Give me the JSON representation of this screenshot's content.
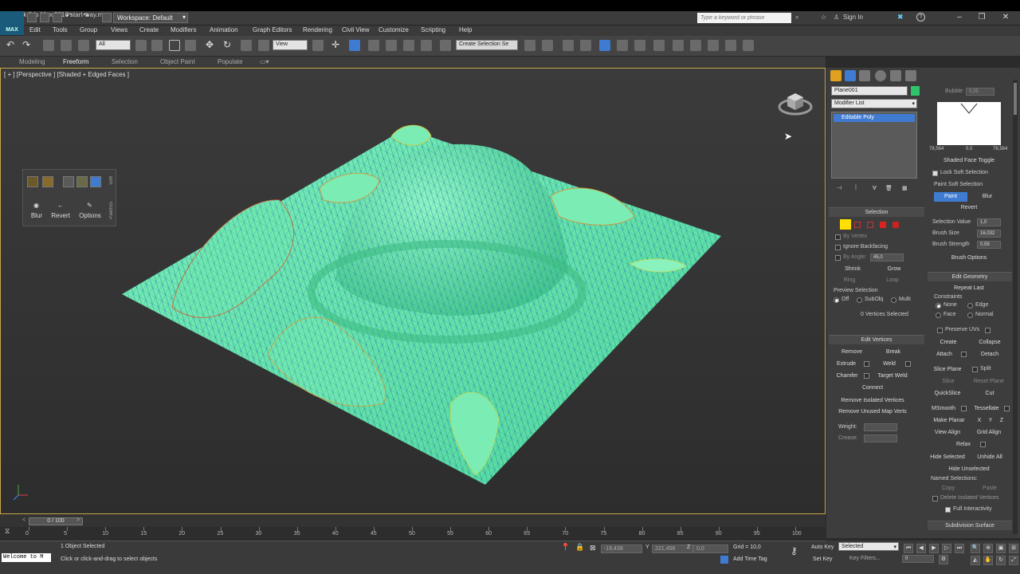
{
  "title_bar": {
    "workspace": "Workspace: Default",
    "app_title": "Autodesk 3ds Max 2016    start vray.max",
    "search_placeholder": "Type a keyword or phrase",
    "sign_in": "Sign In"
  },
  "logo": "MAX",
  "menu": [
    "Edit",
    "Tools",
    "Group",
    "Views",
    "Create",
    "Modifiers",
    "Animation",
    "Graph Editors",
    "Rendering",
    "Civil View",
    "Customize",
    "Scripting",
    "Help"
  ],
  "toolbar": {
    "filter_value": "All",
    "ref_coord_value": "View",
    "selection_set_value": "Create Selection Se"
  },
  "ribbon_tabs": [
    "Modeling",
    "Freeform",
    "Selection",
    "Object Paint",
    "Populate"
  ],
  "viewport": {
    "label": "[ + ] [Perspective ] [Shaded + Edged Faces ]"
  },
  "float_panel": {
    "blur": "Blur",
    "revert": "Revert",
    "options": "Options",
    "side_label_1": "Soft",
    "side_label_2": "PaintSS"
  },
  "command_panel": {
    "object_name": "Plane001",
    "modifier_list": "Modifier List",
    "stack_item": "Editable Poly",
    "selection_header": "Selection",
    "by_vertex": "By Vertex",
    "ignore_backfacing": "Ignore Backfacing",
    "by_angle": "By Angle:",
    "by_angle_value": "45,0",
    "shrink": "Shrink",
    "grow": "Grow",
    "ring": "Ring",
    "loop": "Loop",
    "preview_selection": "Preview Selection",
    "preview_off": "Off",
    "preview_subobj": "SubObj",
    "preview_multi": "Multi",
    "vertices_selected": "0 Vertices Selected",
    "edit_vertices_header": "Edit Vertices",
    "remove": "Remove",
    "break": "Break",
    "extrude": "Extrude",
    "weld": "Weld",
    "chamfer": "Chamfer",
    "target_weld": "Target Weld",
    "connect": "Connect",
    "remove_isolated": "Remove Isolated Vertices",
    "remove_unused": "Remove Unused Map Verts",
    "weight": "Weight:",
    "crease": "Crease:"
  },
  "soft_panel": {
    "bubble": "Bubble:",
    "bubble_value": "0,25",
    "curve_left": "78,564",
    "curve_mid": "0,0",
    "curve_right": "78,564",
    "shaded_face_toggle": "Shaded Face Toggle",
    "lock_soft_selection": "Lock Soft Selection",
    "paint_soft_selection": "Paint Soft Selection",
    "paint": "Paint",
    "blur": "Blur",
    "revert": "Revert",
    "selection_value_label": "Selection Value",
    "selection_value": "1,0",
    "brush_size_label": "Brush Size",
    "brush_size": "16,032",
    "brush_strength_label": "Brush Strength",
    "brush_strength": "0,59",
    "brush_options": "Brush Options",
    "edit_geometry_header": "Edit Geometry",
    "repeat_last": "Repeat Last",
    "constraints": "Constraints",
    "c_none": "None",
    "c_edge": "Edge",
    "c_face": "Face",
    "c_normal": "Normal",
    "preserve_uvs": "Preserve UVs",
    "create": "Create",
    "collapse": "Collapse",
    "attach": "Attach",
    "detach": "Detach",
    "slice_plane": "Slice Plane",
    "split": "Split",
    "slice": "Slice",
    "reset_plane": "Reset Plane",
    "quickslice": "QuickSlice",
    "cut": "Cut",
    "msmooth": "MSmooth",
    "tessellate": "Tessellate",
    "make_planar": "Make Planar",
    "x": "X",
    "y": "Y",
    "z": "Z",
    "view_align": "View Align",
    "grid_align": "Grid Align",
    "relax": "Relax",
    "hide_selected": "Hide Selected",
    "unhide_all": "Unhide All",
    "hide_unselected": "Hide Unselected",
    "named_selections": "Named Selections:",
    "copy": "Copy",
    "paste": "Paste",
    "delete_isolated": "Delete Isolated Vertices",
    "full_interactivity": "Full Interactivity",
    "subdivision_surface": "Subdivision Surface"
  },
  "timeline": {
    "frame_counter": "0 / 100",
    "ticks": [
      "0",
      "5",
      "10",
      "15",
      "20",
      "25",
      "30",
      "35",
      "40",
      "45",
      "50",
      "55",
      "60",
      "65",
      "70",
      "75",
      "80",
      "85",
      "90",
      "95",
      "100"
    ]
  },
  "status": {
    "welcome": "Welcome to M",
    "objects_selected": "1 Object Selected",
    "prompt": "Click or click-and-drag to select objects",
    "x_value": "-19,439",
    "y_value": "221,456",
    "z_value": "0,0",
    "grid": "Grid = 10,0",
    "add_time_tag": "Add Time Tag",
    "auto_key": "Auto Key",
    "set_key": "Set Key",
    "key_mode_value": "Selected",
    "key_filters": "Key Filters...",
    "current_frame": "0"
  },
  "colors": {
    "mesh_fill": "#5fe6a4",
    "selection_accent": "#3f7bd1",
    "viewport_border": "#caa64a"
  }
}
